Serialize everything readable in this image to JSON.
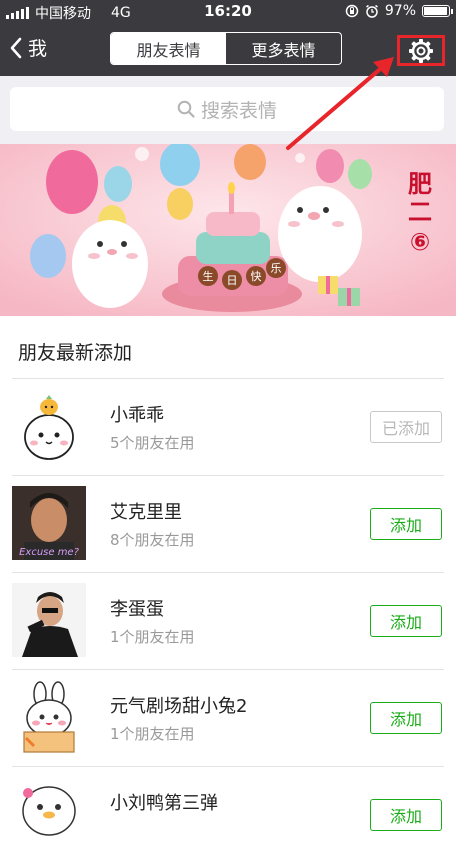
{
  "status": {
    "carrier": "中国移动",
    "network": "4G",
    "time": "16:20",
    "battery": "97%",
    "battery_level": 0.97
  },
  "nav": {
    "back_label": "我",
    "tabs": [
      "朋友表情",
      "更多表情"
    ],
    "active_tab": 0
  },
  "search": {
    "placeholder": "搜索表情"
  },
  "banner": {
    "vertical_text": [
      "肥",
      "二",
      "⑥"
    ],
    "cake_text": [
      "生",
      "日",
      "快",
      "乐"
    ]
  },
  "section": {
    "title": "朋友最新添加"
  },
  "items": [
    {
      "name": "小乖乖",
      "sub": "5个朋友在用",
      "button": "已添加",
      "added": true
    },
    {
      "name": "艾克里里",
      "sub": "8个朋友在用",
      "button": "添加",
      "added": false,
      "thumb_text": "Excuse me?"
    },
    {
      "name": "李蛋蛋",
      "sub": "1个朋友在用",
      "button": "添加",
      "added": false
    },
    {
      "name": "元气剧场甜小兔2",
      "sub": "1个朋友在用",
      "button": "添加",
      "added": false
    },
    {
      "name": "小刘鸭第三弹",
      "sub": "",
      "button": "添加",
      "added": false
    }
  ],
  "colors": {
    "nav_bg": "#3b3b3f",
    "accent_green": "#1aad19",
    "highlight_red": "#e8252a",
    "search_bg": "#efeff4"
  }
}
